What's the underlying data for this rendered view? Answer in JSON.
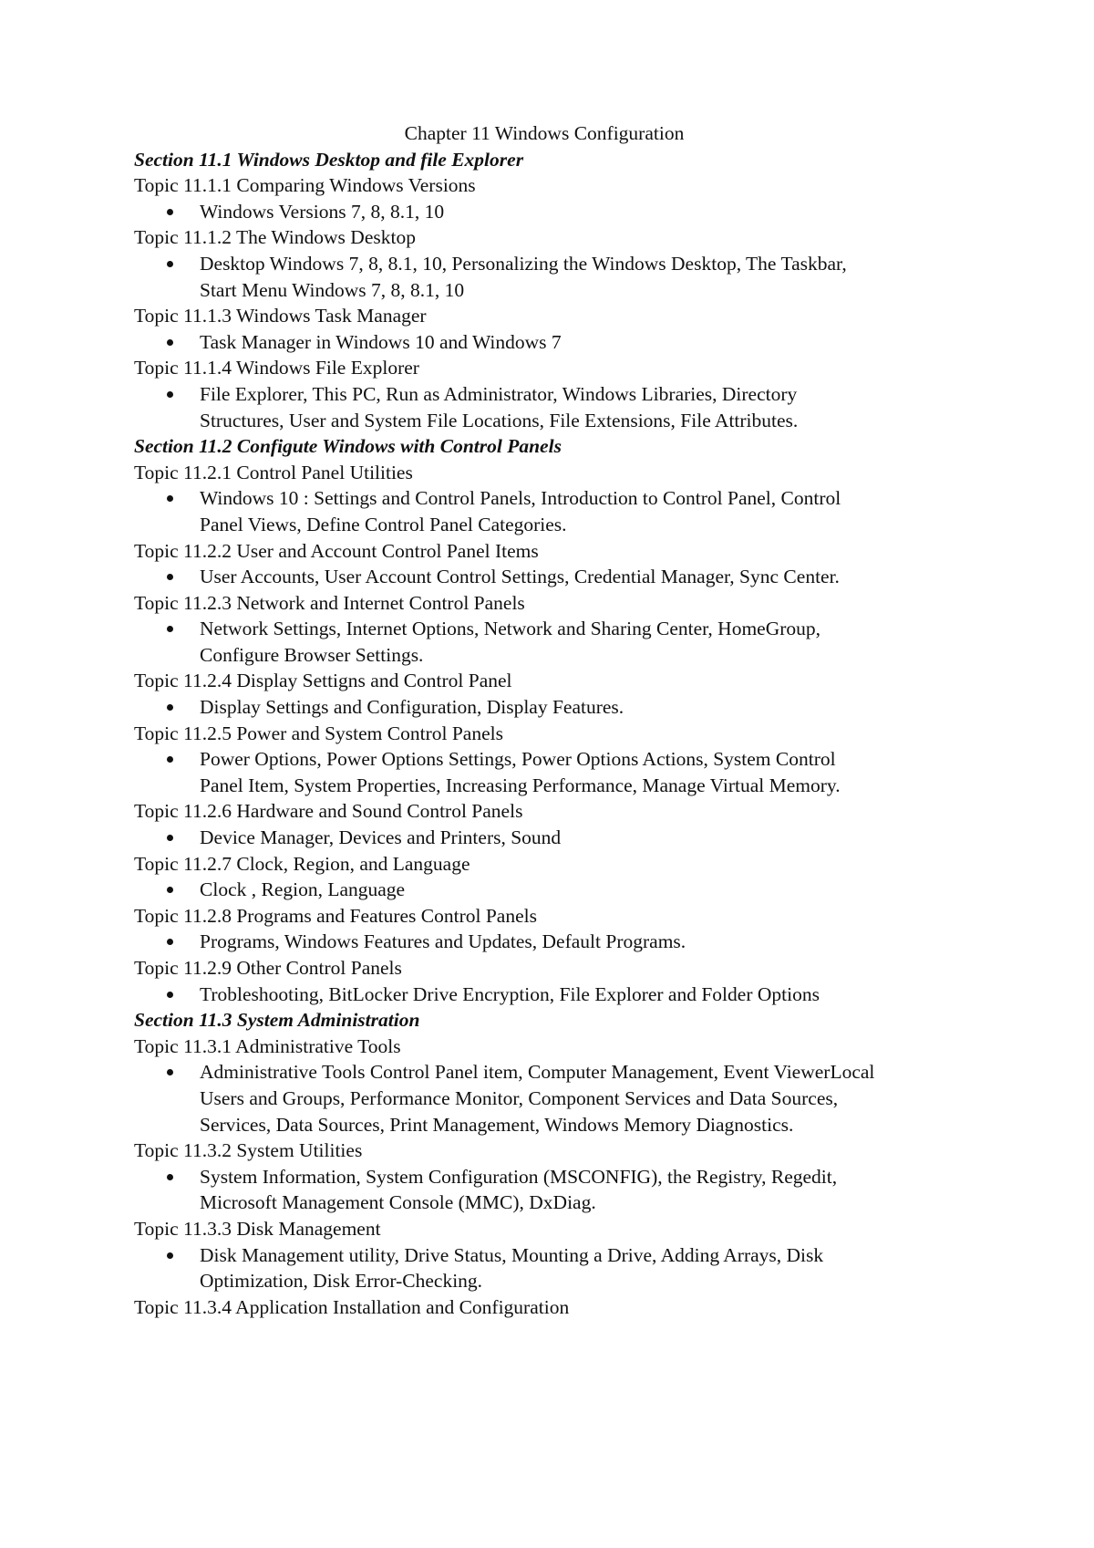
{
  "document": {
    "title": "Chapter 11 Windows Configuration",
    "sections": [
      {
        "heading": "Section 11.1 Windows Desktop and file Explorer",
        "topics": [
          {
            "heading": "Topic 11.1.1 Comparing Windows Versions",
            "bullet_lines": [
              "Windows Versions 7, 8, 8.1, 10"
            ]
          },
          {
            "heading": "Topic 11.1.2 The Windows Desktop",
            "bullet_lines": [
              "Desktop Windows 7, 8, 8.1, 10, Personalizing the Windows Desktop, The Taskbar,",
              "Start Menu Windows 7, 8, 8.1, 10"
            ]
          },
          {
            "heading": "Topic 11.1.3 Windows Task Manager",
            "bullet_lines": [
              "Task Manager in Windows 10 and Windows 7"
            ]
          },
          {
            "heading": "Topic 11.1.4 Windows File Explorer",
            "bullet_lines": [
              "File Explorer, This PC, Run as Administrator, Windows Libraries, Directory",
              "Structures, User and System File Locations, File Extensions, File Attributes."
            ]
          }
        ]
      },
      {
        "heading": "Section 11.2 Configute Windows with Control Panels",
        "topics": [
          {
            "heading": "Topic 11.2.1 Control Panel Utilities",
            "bullet_lines": [
              "Windows 10 : Settings and Control Panels, Introduction to Control Panel, Control",
              "Panel Views, Define Control Panel Categories."
            ]
          },
          {
            "heading": "Topic 11.2.2 User and Account Control Panel Items",
            "bullet_lines": [
              "User Accounts, User Account Control Settings, Credential Manager, Sync Center."
            ]
          },
          {
            "heading": "Topic 11.2.3 Network and Internet Control Panels",
            "bullet_lines": [
              "Network Settings, Internet Options, Network and Sharing Center, HomeGroup,",
              "Configure Browser Settings."
            ]
          },
          {
            "heading": "Topic 11.2.4 Display Settigns and Control Panel",
            "bullet_lines": [
              "Display Settings and Configuration, Display Features."
            ]
          },
          {
            "heading": "Topic 11.2.5 Power and System Control Panels",
            "bullet_lines": [
              "Power Options, Power Options Settings, Power Options Actions, System Control",
              "Panel Item, System Properties, Increasing Performance, Manage Virtual Memory."
            ]
          },
          {
            "heading": "Topic 11.2.6 Hardware and Sound Control Panels",
            "bullet_lines": [
              "Device Manager, Devices and Printers, Sound"
            ]
          },
          {
            "heading": "Topic 11.2.7 Clock, Region,  and Language",
            "bullet_lines": [
              "Clock , Region, Language"
            ]
          },
          {
            "heading": "Topic 11.2.8 Programs and Features Control Panels",
            "bullet_lines": [
              "Programs, Windows Features and Updates, Default Programs."
            ]
          },
          {
            "heading": "Topic 11.2.9 Other Control Panels",
            "bullet_lines": [
              "Trobleshooting, BitLocker Drive Encryption, File Explorer and Folder Options"
            ]
          }
        ]
      },
      {
        "heading": "Section 11.3 System Administration",
        "topics": [
          {
            "heading": "Topic 11.3.1 Administrative Tools",
            "bullet_lines": [
              "Administrative Tools Control Panel item, Computer Management, Event ViewerLocal",
              "Users and Groups, Performance Monitor, Component Services and Data Sources,",
              "Services, Data Sources, Print Management, Windows Memory Diagnostics."
            ]
          },
          {
            "heading": "Topic 11.3.2 System Utilities",
            "bullet_lines": [
              "System Information, System Configuration (MSCONFIG), the Registry, Regedit,",
              "Microsoft Management Console (MMC), DxDiag."
            ]
          },
          {
            "heading": "Topic 11.3.3 Disk Management",
            "bullet_lines": [
              "Disk Management utility, Drive Status, Mounting a Drive, Adding Arrays, Disk",
              "Optimization, Disk Error-Checking."
            ]
          },
          {
            "heading": "Topic 11.3.4 Application Installation and Configuration",
            "bullet_lines": []
          }
        ]
      }
    ]
  }
}
